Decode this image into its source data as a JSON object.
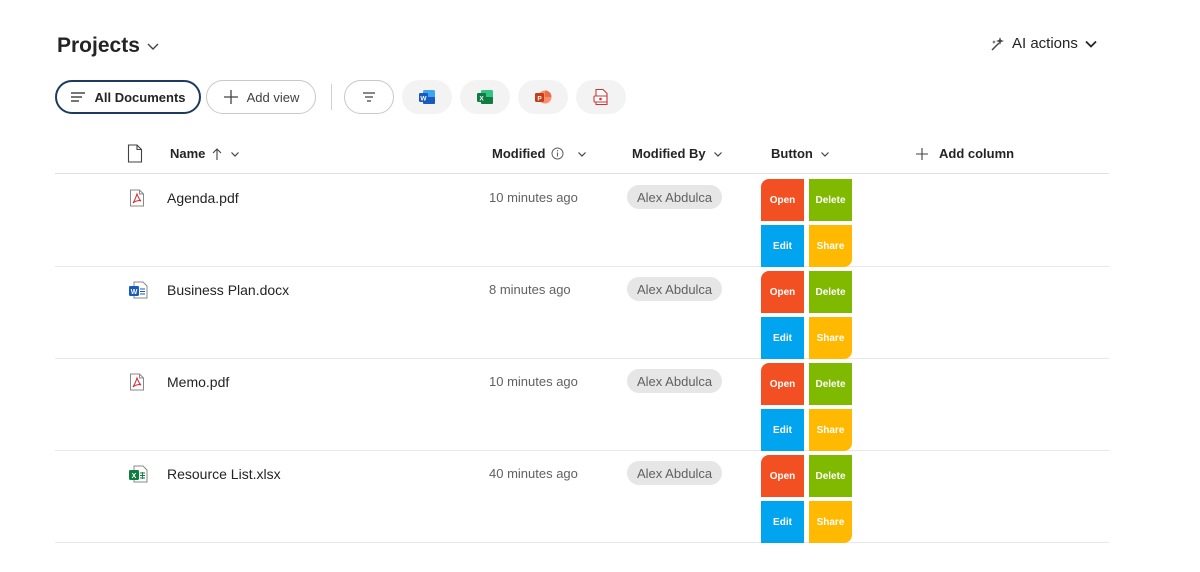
{
  "header": {
    "title": "Projects",
    "ai_actions": "AI actions"
  },
  "toolbar": {
    "all_documents": "All Documents",
    "add_view": "Add view"
  },
  "columns": {
    "name": "Name",
    "modified": "Modified",
    "modified_by": "Modified By",
    "button": "Button",
    "add_column": "Add column"
  },
  "rows": [
    {
      "name": "Agenda.pdf",
      "type": "pdf-icon",
      "modified": "10 minutes ago",
      "modified_by": "Alex Abdulca"
    },
    {
      "name": "Business Plan.docx",
      "type": "word-icon",
      "modified": "8 minutes ago",
      "modified_by": "Alex Abdulca"
    },
    {
      "name": "Memo.pdf",
      "type": "pdf-icon",
      "modified": "10 minutes ago",
      "modified_by": "Alex Abdulca"
    },
    {
      "name": "Resource List.xlsx",
      "type": "excel-icon",
      "modified": "40 minutes ago",
      "modified_by": "Alex Abdulca"
    }
  ],
  "row_buttons": {
    "open": "Open",
    "delete": "Delete",
    "edit": "Edit",
    "share": "Share"
  },
  "colors": {
    "open": "#f25022",
    "delete": "#7fba00",
    "edit": "#00a4ef",
    "share": "#ffb900",
    "view_border": "#1c3a5e"
  }
}
